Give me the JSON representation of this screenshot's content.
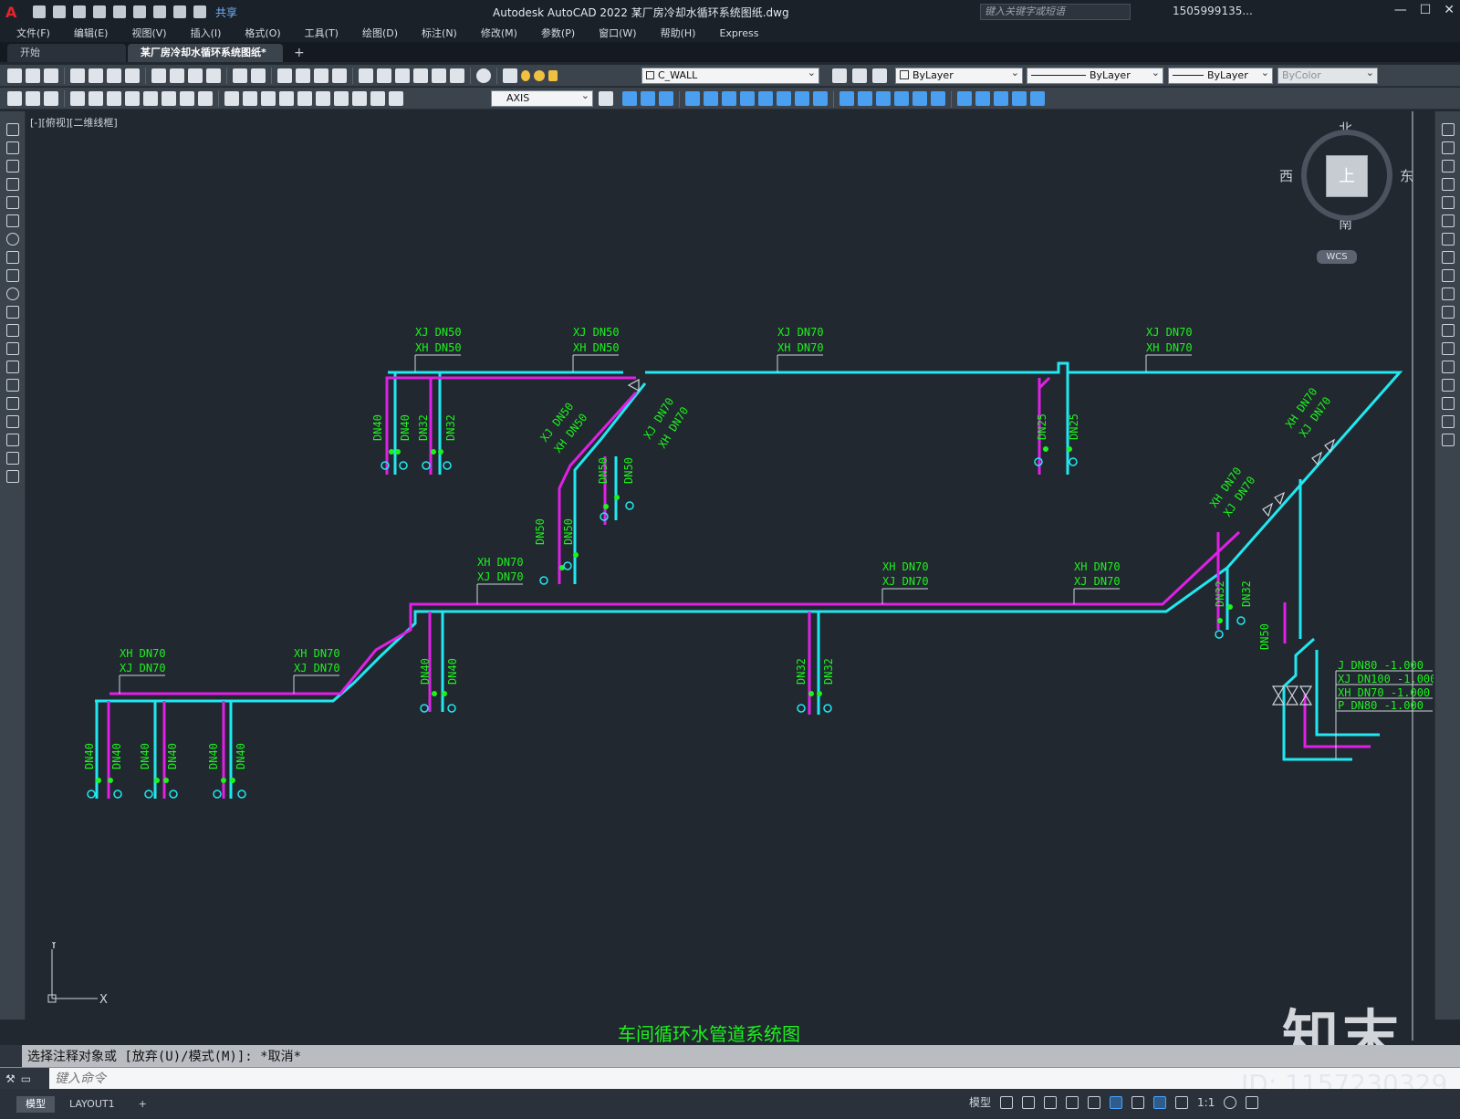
{
  "titlebar": {
    "logo": "A",
    "share_label": "共享",
    "title": "Autodesk AutoCAD 2022    某厂房冷却水循环系统图纸.dwg",
    "search_placeholder": "键入关键字或短语",
    "user": "1505999135...",
    "min": "—",
    "max": "☐",
    "close": "✕"
  },
  "menu": [
    "文件(F)",
    "编辑(E)",
    "视图(V)",
    "插入(I)",
    "格式(O)",
    "工具(T)",
    "绘图(D)",
    "标注(N)",
    "修改(M)",
    "参数(P)",
    "窗口(W)",
    "帮助(H)",
    "Express"
  ],
  "tabs": {
    "start": "开始",
    "drawing": "某厂房冷却水循环系统图纸*",
    "close": "✕",
    "add": "+"
  },
  "toolbar": {
    "layer": "C_WALL",
    "color": "ByLayer",
    "linetype": "ByLayer",
    "lineweight": "ByLayer",
    "plotstyle": "ByColor",
    "dimstyle": "AXIS"
  },
  "viewport_label": "[-][俯视][二维线框]",
  "viewcube": {
    "north": "北",
    "south": "南",
    "east": "东",
    "west": "西",
    "face": "上",
    "wcs": "WCS"
  },
  "ucs": {
    "x": "X",
    "y": "Y"
  },
  "drawing": {
    "title": "车间循环水管道系统图",
    "colors": {
      "supply": "#21e8f0",
      "return": "#e020e6",
      "label": "#1df21d"
    },
    "labels": {
      "l1_top": "XJ DN50",
      "l1_bot": "XH DN50",
      "l2_top": "XJ DN50",
      "l2_bot": "XH DN50",
      "l3_top": "XJ DN70",
      "l3_bot": "XH DN70",
      "l4_top": "XJ DN70",
      "l4_bot": "XH DN70",
      "l5_top": "XH DN70",
      "l5_bot": "XJ DN70",
      "l6_top": "XH DN70",
      "l6_bot": "XJ DN70",
      "l7_top": "XH DN70",
      "l7_bot": "XJ DN70",
      "l8_top": "XH DN70",
      "l8_bot": "XJ DN70",
      "l9_top": "XH DN70",
      "l9_bot": "XJ DN70",
      "diag1_top": "XJ DN50",
      "diag1_bot": "XH DN50",
      "diag2_top": "XJ DN70",
      "diag2_bot": "XH DN70",
      "diag3_top": "XH DN70",
      "diag3_bot": "XJ DN70",
      "diag4_top": "XH DN70",
      "diag4_bot": "XJ DN70",
      "v_dn40": "DN40",
      "v_dn32": "DN32",
      "v_dn25": "DN25",
      "v_dn50": "DN50",
      "r1": "J DN80  -1.000",
      "r2": "XJ DN100 -1.000",
      "r3": "XH DN70 -1.000",
      "r4": "P DN80 -1.000"
    }
  },
  "command": {
    "history": "选择注释对象或 [放弃(U)/模式(M)]: *取消*",
    "placeholder": "键入命令"
  },
  "status": {
    "model_tab": "模型",
    "layout_tab": "LAYOUT1",
    "add": "+",
    "model": "模型",
    "scale": "1:1"
  },
  "watermark": {
    "brand": "知末",
    "id": "ID: 1157230329"
  }
}
